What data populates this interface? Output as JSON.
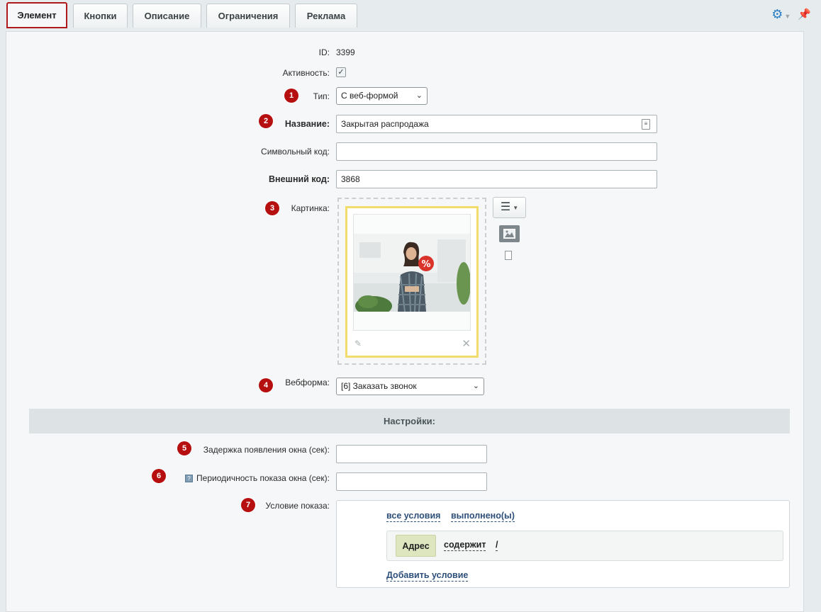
{
  "tabs": [
    {
      "label": "Элемент",
      "active": true
    },
    {
      "label": "Кнопки"
    },
    {
      "label": "Описание"
    },
    {
      "label": "Ограничения"
    },
    {
      "label": "Реклама"
    }
  ],
  "form": {
    "id": {
      "label": "ID:",
      "value": "3399"
    },
    "active": {
      "label": "Активность:",
      "checked": true
    },
    "type": {
      "label": "Тип:",
      "selected": "С веб-формой",
      "badge": "1"
    },
    "name": {
      "label": "Название:",
      "value": "Закрытая распродажа",
      "badge": "2"
    },
    "code": {
      "label": "Символьный код:",
      "value": ""
    },
    "external_code": {
      "label": "Внешний код:",
      "value": "3868"
    },
    "picture": {
      "label": "Картинка:",
      "badge": "3"
    },
    "webform": {
      "label": "Вебформа:",
      "selected": "[6] Заказать звонок",
      "badge": "4"
    }
  },
  "settings": {
    "title": "Настройки:",
    "delay": {
      "label": "Задержка появления окна (сек):",
      "value": "",
      "badge": "5"
    },
    "period": {
      "label": "Периодичность показа окна (сек):",
      "value": "",
      "badge": "6",
      "help": "?"
    },
    "condition": {
      "label": "Условие показа:",
      "badge": "7",
      "scope": "все условия",
      "state": "выполнено(ы)",
      "rule": {
        "field": "Адрес",
        "operator": "содержит",
        "value": "/"
      },
      "add": "Добавить условие"
    }
  },
  "colors": {
    "accent": "#b5100f",
    "link": "#2d4f7a",
    "section_bg": "#dde3e5"
  }
}
